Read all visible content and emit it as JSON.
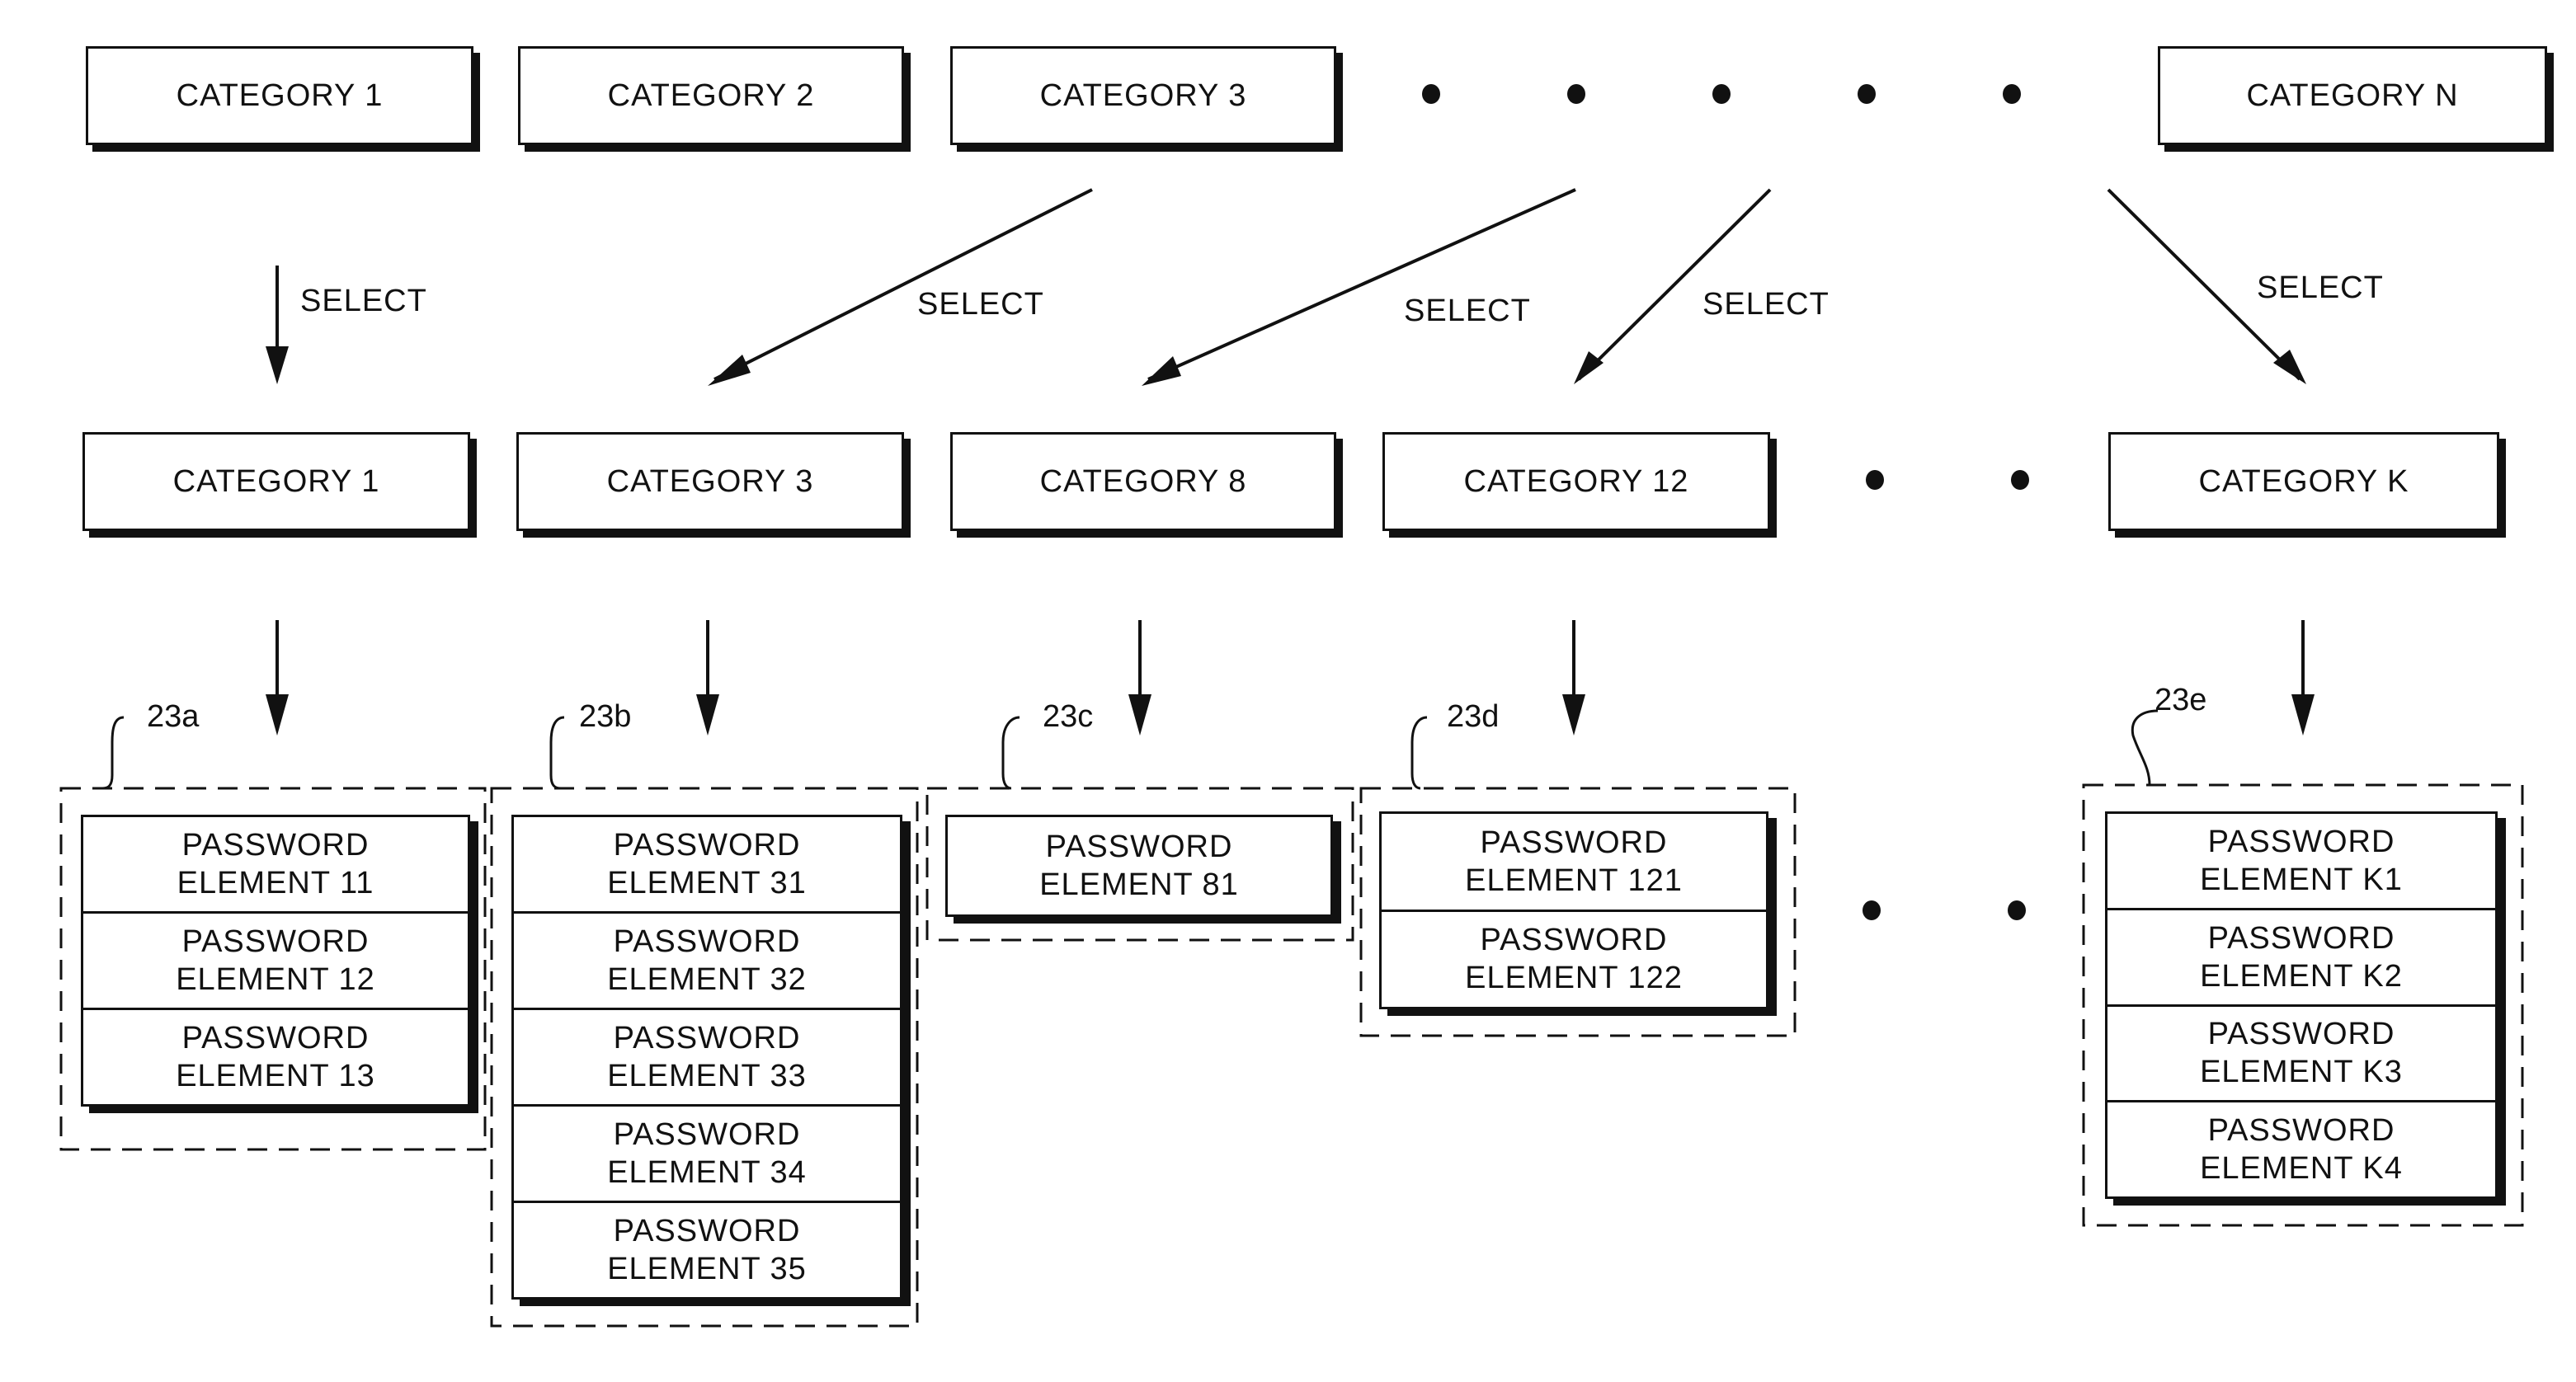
{
  "top_categories": [
    {
      "label": "CATEGORY 1"
    },
    {
      "label": "CATEGORY 2"
    },
    {
      "label": "CATEGORY 3"
    },
    {
      "label": "CATEGORY N"
    }
  ],
  "select_label": "SELECT",
  "selected_categories": [
    {
      "label": "CATEGORY 1"
    },
    {
      "label": "CATEGORY 3"
    },
    {
      "label": "CATEGORY 8"
    },
    {
      "label": "CATEGORY 12"
    },
    {
      "label": "CATEGORY K"
    }
  ],
  "groups": [
    {
      "ref": "23a",
      "elements": [
        "PASSWORD\nELEMENT 11",
        "PASSWORD\nELEMENT 12",
        "PASSWORD\nELEMENT 13"
      ]
    },
    {
      "ref": "23b",
      "elements": [
        "PASSWORD\nELEMENT 31",
        "PASSWORD\nELEMENT 32",
        "PASSWORD\nELEMENT 33",
        "PASSWORD\nELEMENT 34",
        "PASSWORD\nELEMENT 35"
      ]
    },
    {
      "ref": "23c",
      "elements": [
        "PASSWORD\nELEMENT 81"
      ]
    },
    {
      "ref": "23d",
      "elements": [
        "PASSWORD\nELEMENT 121",
        "PASSWORD\nELEMENT 122"
      ]
    },
    {
      "ref": "23e",
      "elements": [
        "PASSWORD\nELEMENT K1",
        "PASSWORD\nELEMENT K2",
        "PASSWORD\nELEMENT K3",
        "PASSWORD\nELEMENT K4"
      ]
    }
  ]
}
